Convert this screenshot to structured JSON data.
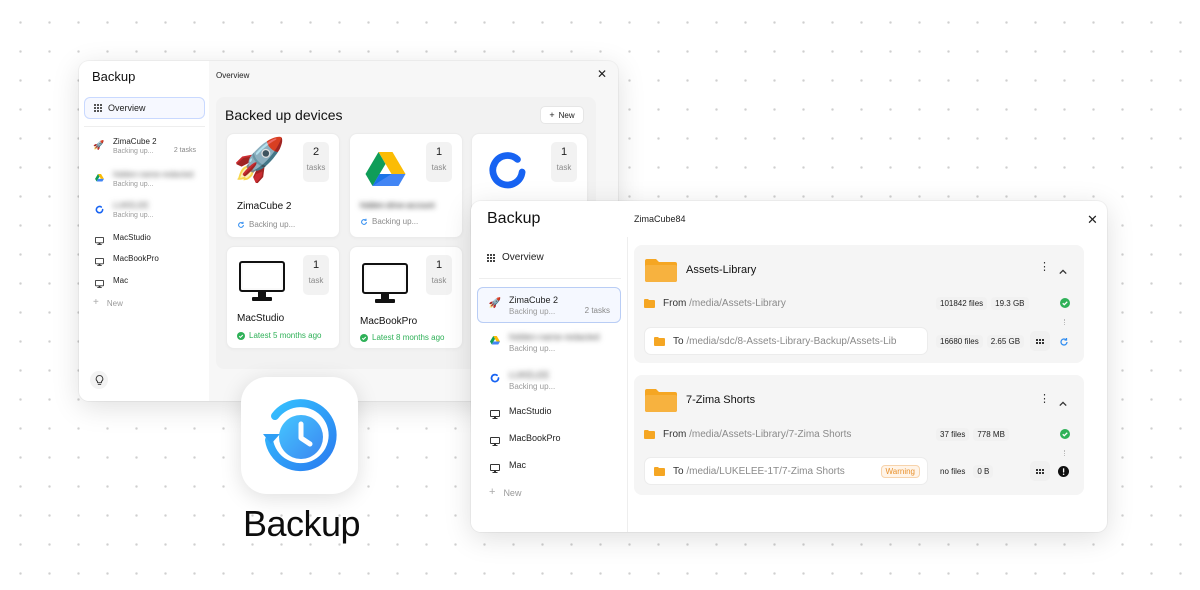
{
  "colors": {
    "accent": "#2f8cf0",
    "success": "#2fb158",
    "warning": "#e8912d",
    "folder": "#f5a623",
    "text_muted": "#8a8a8a"
  },
  "back_window": {
    "app_title": "Backup",
    "header_title": "Overview",
    "sidebar": {
      "overview_label": "Overview",
      "items": [
        {
          "icon": "rocket-icon",
          "title": "ZimaCube 2",
          "subtitle": "Backing up...",
          "meta": "2 tasks"
        },
        {
          "icon": "google-drive-icon",
          "title": "hidden-name-redacted",
          "subtitle": "Backing up...",
          "meta": ""
        },
        {
          "icon": "sync-cloud-icon",
          "title": "LUKELEE",
          "subtitle": "Backing up...",
          "meta": ""
        },
        {
          "icon": "monitor-icon",
          "title": "MacStudio",
          "subtitle": "",
          "meta": ""
        },
        {
          "icon": "monitor-icon",
          "title": "MacBookPro",
          "subtitle": "",
          "meta": ""
        },
        {
          "icon": "monitor-icon",
          "title": "Mac",
          "subtitle": "",
          "meta": ""
        }
      ],
      "new_label": "New"
    },
    "main": {
      "section_title": "Backed up devices",
      "new_button_label": "New",
      "cards": [
        {
          "name": "ZimaCube 2",
          "count": "2",
          "unit": "tasks",
          "status": "Backing up...",
          "status_type": "syncing"
        },
        {
          "name": "hidden-drive-account",
          "count": "1",
          "unit": "task",
          "status": "Backing up...",
          "status_type": "syncing"
        },
        {
          "name": "",
          "count": "1",
          "unit": "task",
          "status": "",
          "status_type": "none"
        },
        {
          "name": "MacStudio",
          "count": "1",
          "unit": "task",
          "status": "Latest 5 months ago",
          "status_type": "ok"
        },
        {
          "name": "MacBookPro",
          "count": "1",
          "unit": "task",
          "status": "Latest 8 months ago",
          "status_type": "ok"
        }
      ]
    }
  },
  "front_window": {
    "app_title": "Backup",
    "header_title": "ZimaCube84",
    "sidebar": {
      "overview_label": "Overview",
      "items": [
        {
          "icon": "rocket-icon",
          "title": "ZimaCube 2",
          "subtitle": "Backing up...",
          "meta": "2 tasks"
        },
        {
          "icon": "google-drive-icon",
          "title": "hidden-name-redacted",
          "subtitle": "Backing up...",
          "meta": ""
        },
        {
          "icon": "sync-cloud-icon",
          "title": "LUKELEE",
          "subtitle": "Backing up...",
          "meta": ""
        },
        {
          "icon": "monitor-icon",
          "title": "MacStudio",
          "subtitle": "",
          "meta": ""
        },
        {
          "icon": "monitor-icon",
          "title": "MacBookPro",
          "subtitle": "",
          "meta": ""
        },
        {
          "icon": "monitor-icon",
          "title": "Mac",
          "subtitle": "",
          "meta": ""
        }
      ],
      "new_label": "New"
    },
    "tasks": [
      {
        "folder_name": "Assets-Library",
        "from_prefix": "From",
        "from_path": "/media/Assets-Library",
        "from_files": "101842 files",
        "from_size": "19.3 GB",
        "to_prefix": "To",
        "to_path": "/media/sdc/8-Assets-Library-Backup/Assets-Lib",
        "to_files": "16680 files",
        "to_size": "2.65 GB",
        "warning": "",
        "from_status": "ok",
        "to_status": "syncing"
      },
      {
        "folder_name": "7-Zima Shorts",
        "from_prefix": "From",
        "from_path": "/media/Assets-Library/7-Zima Shorts",
        "from_files": "37 files",
        "from_size": "778 MB",
        "to_prefix": "To",
        "to_path": "/media/LUKELEE-1T/7-Zima Shorts",
        "to_files": "no files",
        "to_size": "0 B",
        "warning": "Warning",
        "from_status": "ok",
        "to_status": "error"
      }
    ]
  },
  "app_icon": {
    "name": "clock-history-icon",
    "label": "Backup"
  }
}
